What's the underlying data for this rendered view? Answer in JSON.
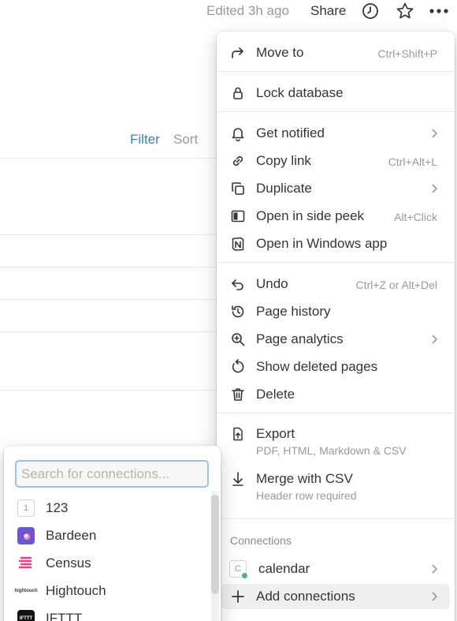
{
  "topbar": {
    "edited": "Edited 3h ago",
    "share": "Share",
    "icons": [
      "clock-icon",
      "star-icon",
      "more-icon"
    ]
  },
  "view": {
    "filter": "Filter",
    "sort": "Sort"
  },
  "menu": {
    "items": [
      {
        "label": "Move to",
        "shortcut": "Ctrl+Shift+P",
        "icon": "arrow-turn-icon"
      },
      {
        "label": "Lock database",
        "icon": "lock-icon"
      },
      {
        "label": "Get notified",
        "icon": "bell-icon"
      },
      {
        "label": "Copy link",
        "shortcut": "Ctrl+Alt+L",
        "icon": "link-icon"
      },
      {
        "label": "Duplicate",
        "icon": "duplicate-icon"
      },
      {
        "label": "Open in side peek",
        "shortcut": "Alt+Click",
        "icon": "side-peek-icon"
      },
      {
        "label": "Open in Windows app",
        "icon": "notion-icon"
      },
      {
        "label": "Undo",
        "shortcut": "Ctrl+Z or Alt+Del",
        "icon": "undo-icon"
      },
      {
        "label": "Page history",
        "icon": "history-icon"
      },
      {
        "label": "Page analytics",
        "icon": "analytics-icon"
      },
      {
        "label": "Show deleted pages",
        "icon": "restore-icon"
      },
      {
        "label": "Delete",
        "icon": "trash-icon"
      },
      {
        "label": "Export",
        "sub": "PDF, HTML, Markdown & CSV",
        "icon": "export-icon"
      },
      {
        "label": "Merge with CSV",
        "sub": "Header row required",
        "icon": "download-arrow-icon"
      },
      {
        "label": "calendar",
        "icon": "calendar-connection-icon"
      },
      {
        "label": "Add connections",
        "icon": "plus-icon"
      }
    ],
    "connections_header": "Connections"
  },
  "popup": {
    "search_placeholder": "Search for connections...",
    "items": [
      {
        "label": "123",
        "badge": "1"
      },
      {
        "label": "Bardeen"
      },
      {
        "label": "Census"
      },
      {
        "label": "Hightouch",
        "logo_text": "hightouch"
      },
      {
        "label": "IFTTT",
        "logo_text": "IFTTT"
      }
    ],
    "connection_badge": "C"
  },
  "colors": {
    "accent": "#2f80d1",
    "search_border": "#96c2ec",
    "bardeen": "#6d55d6",
    "census": "#ee3f8a"
  }
}
